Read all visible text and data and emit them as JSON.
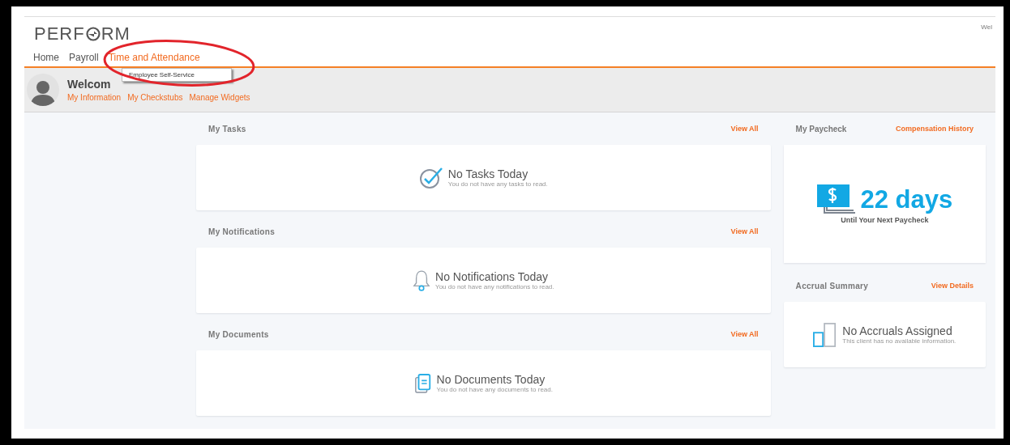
{
  "brand": {
    "before": "PERF",
    "after": "RM"
  },
  "corner_text": "Wel",
  "nav": [
    {
      "label": "Home",
      "selected": false
    },
    {
      "label": "Payroll",
      "selected": false
    },
    {
      "label": "Time and Attendance",
      "selected": true
    }
  ],
  "dropdown": {
    "items": [
      "Employee Self-Service"
    ]
  },
  "welcome": {
    "title": "Welcom",
    "links": [
      "My Information",
      "My Checkstubs",
      "Manage Widgets"
    ]
  },
  "widgets": [
    {
      "kind": "tasks",
      "title": "My Tasks",
      "action": "View All",
      "heading": "No Tasks Today",
      "message": "You do not have any tasks to read."
    },
    {
      "kind": "notifications",
      "title": "My Notifications",
      "action": "View All",
      "heading": "No Notifications Today",
      "message": "You do not have any notifications to read."
    },
    {
      "kind": "documents",
      "title": "My Documents",
      "action": "View All",
      "heading": "No Documents Today",
      "message": "You do not have any documents to read."
    }
  ],
  "paycheck": {
    "title": "My Paycheck",
    "action": "Compensation History",
    "days": "22 days",
    "caption": "Until Your Next Paycheck"
  },
  "accrual": {
    "kind": "accruals",
    "title": "Accrual Summary",
    "action": "View Details",
    "heading": "No Accruals Assigned",
    "message": "This client has no available information."
  }
}
